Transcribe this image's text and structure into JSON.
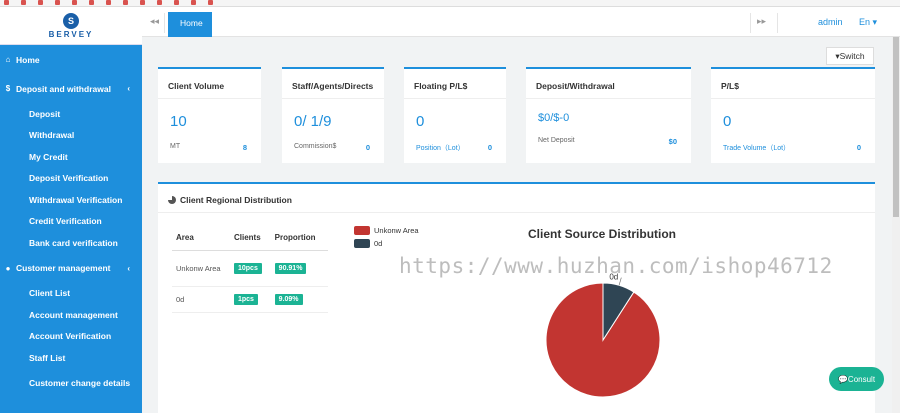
{
  "brand": {
    "name": "BERVEY",
    "accent": "#1e8fdc",
    "green": "#1bb394"
  },
  "sidebar": {
    "items": [
      {
        "label": "Home",
        "icon": "home-icon"
      },
      {
        "label": "Deposit and withdrawal",
        "icon": "dollar-icon"
      },
      {
        "label": "Deposit"
      },
      {
        "label": "Withdrawal"
      },
      {
        "label": "My Credit"
      },
      {
        "label": "Deposit Verification"
      },
      {
        "label": "Withdrawal Verification"
      },
      {
        "label": "Credit Verification"
      },
      {
        "label": "Bank card verification"
      },
      {
        "label": "Customer management",
        "icon": "user-icon"
      },
      {
        "label": "Client List"
      },
      {
        "label": "Account management"
      },
      {
        "label": "Account Verification"
      },
      {
        "label": "Staff List"
      },
      {
        "label": "Customer change details"
      }
    ]
  },
  "topbar": {
    "tab_home": "Home",
    "user": "admin",
    "lang": "En"
  },
  "toolbar": {
    "switch_label": "▾Switch"
  },
  "cards": [
    {
      "title": "Client Volume",
      "value": "10",
      "sub": "MT",
      "num": "8"
    },
    {
      "title": "Staff/Agents/Directs",
      "value": "0/ 1/9",
      "sub": "Commission$",
      "num": "0"
    },
    {
      "title": "Floating P/L$",
      "value": "0",
      "sub": "Position（Lot）",
      "num": "0"
    },
    {
      "title": "Deposit/Withdrawal",
      "value": "$0/$-0",
      "sub": "Net Deposit",
      "num": "$0"
    },
    {
      "title": "P/L$",
      "value": "0",
      "sub": "Trade Volume（Lot）",
      "num": "0"
    }
  ],
  "region": {
    "title": "Client Regional Distribution",
    "headers": [
      "Area",
      "Clients",
      "Proportion"
    ],
    "rows": [
      {
        "area": "Unkonw Area",
        "clients": "10pcs",
        "proportion": "90.91%"
      },
      {
        "area": "0d",
        "clients": "1pcs",
        "proportion": "9.09%"
      }
    ]
  },
  "chart_data": {
    "type": "pie",
    "title": "Client Source Distribution",
    "categories": [
      "Unkonw Area",
      "0d"
    ],
    "values": [
      10,
      1
    ],
    "colors": [
      "#c23531",
      "#2f4554"
    ],
    "legend": "top-left",
    "labels": [
      "0d"
    ]
  },
  "watermark": "https://www.huzhan.com/ishop46712",
  "consult_label": "Consult"
}
